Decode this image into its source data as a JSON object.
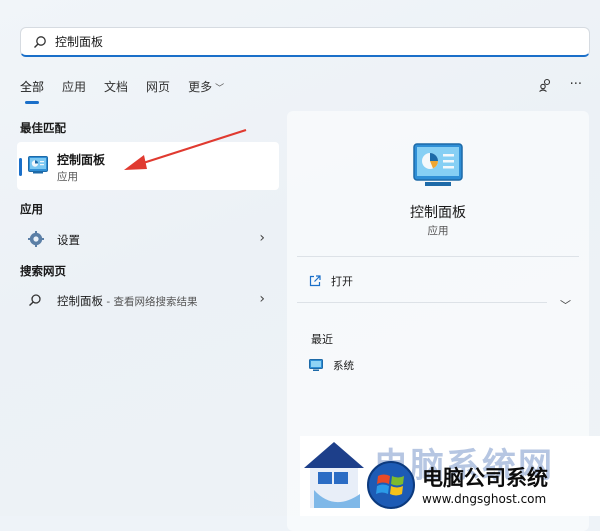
{
  "search": {
    "value": "控制面板"
  },
  "tabs": [
    {
      "label": "全部",
      "active": true
    },
    {
      "label": "应用",
      "active": false
    },
    {
      "label": "文档",
      "active": false
    },
    {
      "label": "网页",
      "active": false
    },
    {
      "label": "更多",
      "active": false,
      "has_dropdown": true
    }
  ],
  "top_actions": {
    "more_label": "···"
  },
  "best_match": {
    "heading": "最佳匹配",
    "item": {
      "name": "控制面板",
      "type": "应用",
      "icon": "control-panel-icon"
    }
  },
  "apps": {
    "heading": "应用",
    "items": [
      {
        "label": "设置",
        "icon": "gear-icon"
      }
    ]
  },
  "web": {
    "heading": "搜索网页",
    "items": [
      {
        "label": "控制面板",
        "suffix": " - 查看网络搜索结果",
        "icon": "search-icon"
      }
    ]
  },
  "detail": {
    "title": "控制面板",
    "type": "应用",
    "open_label": "打开",
    "recent_heading": "最近",
    "recent_items": [
      {
        "label": "系统",
        "icon": "system-icon"
      }
    ]
  },
  "watermark": {
    "back_text": "电脑系统网",
    "main_text": "电脑公司系统",
    "url": "www.dngsghost.com"
  },
  "colors": {
    "accent": "#1a6fc9",
    "annotation": "#e03a30"
  }
}
